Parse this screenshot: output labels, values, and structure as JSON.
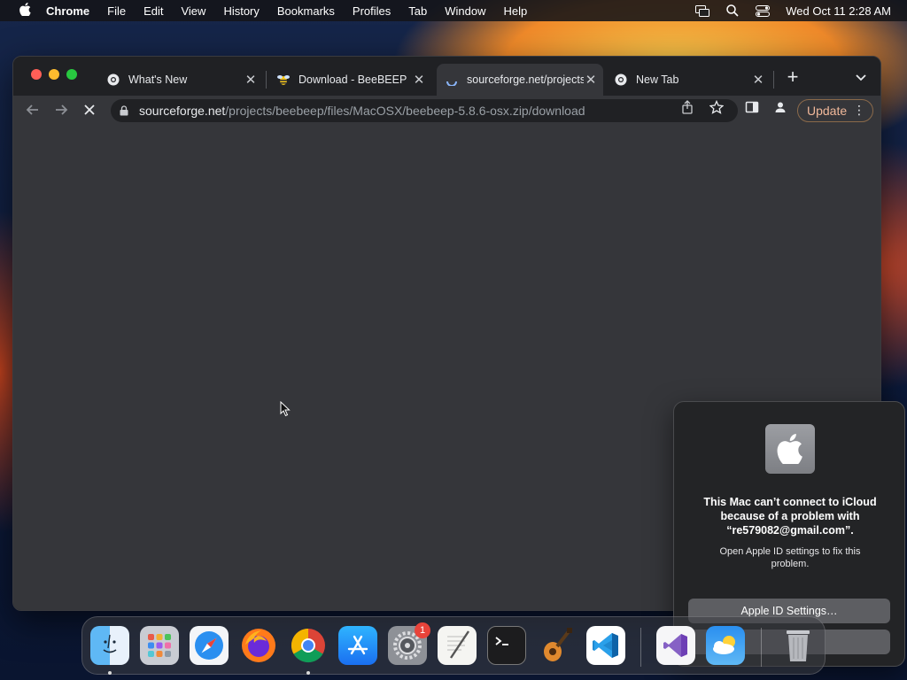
{
  "menubar": {
    "apple_icon": "apple-logo-icon",
    "items": [
      "Chrome",
      "File",
      "Edit",
      "View",
      "History",
      "Bookmarks",
      "Profiles",
      "Tab",
      "Window",
      "Help"
    ],
    "datetime": "Wed Oct 11  2:28 AM",
    "status_icons": [
      "screen-mirroring-icon",
      "spotlight-search-icon",
      "control-center-icon"
    ]
  },
  "browser": {
    "tabs": [
      {
        "title": "What's New",
        "icon": "chrome-icon",
        "active": false
      },
      {
        "title": "Download - BeeBEEP",
        "icon": "beebeep-icon",
        "active": false
      },
      {
        "title": "sourceforge.net/projects/beebeep",
        "icon": "loading-spinner-icon",
        "active": true
      },
      {
        "title": "New Tab",
        "icon": "chrome-icon",
        "active": false
      }
    ],
    "tab_close_glyph": "✕",
    "new_tab_glyph": "+",
    "omnibox": {
      "domain": "sourceforge.net",
      "path": "/projects/beebeep/files/MacOSX/beebeep-5.8.6-osx.zip/download"
    },
    "update_label": "Update",
    "colors": {
      "accent": "#f0b89a",
      "page_bg": "#35363a",
      "frame_bg": "#202124"
    }
  },
  "notification": {
    "title": "This Mac can’t connect to iCloud because of a problem with “re579082@gmail.com”.",
    "body": "Open Apple ID settings to fix this problem.",
    "primary_button": "Apple ID Settings…",
    "secondary_button": ""
  },
  "dock": {
    "apps": [
      {
        "name": "Finder",
        "icon": "finder-icon",
        "running": true
      },
      {
        "name": "Launchpad",
        "icon": "launchpad-icon",
        "running": false
      },
      {
        "name": "Safari",
        "icon": "safari-icon",
        "running": false
      },
      {
        "name": "Firefox",
        "icon": "firefox-icon",
        "running": false
      },
      {
        "name": "Google Chrome",
        "icon": "chrome-icon",
        "running": true
      },
      {
        "name": "App Store",
        "icon": "app-store-icon",
        "running": false
      },
      {
        "name": "System Settings",
        "icon": "system-settings-icon",
        "running": false,
        "badge": "1"
      },
      {
        "name": "TextEdit",
        "icon": "textedit-icon",
        "running": false
      },
      {
        "name": "Terminal",
        "icon": "terminal-icon",
        "running": false
      },
      {
        "name": "GarageBand",
        "icon": "garageband-icon",
        "running": false
      },
      {
        "name": "Visual Studio Code",
        "icon": "vscode-icon",
        "running": false
      },
      {
        "name": "Visual Studio",
        "icon": "visual-studio-icon",
        "running": false
      },
      {
        "name": "Weather",
        "icon": "weather-icon",
        "running": false
      },
      {
        "name": "Trash",
        "icon": "trash-icon",
        "running": false
      }
    ]
  }
}
